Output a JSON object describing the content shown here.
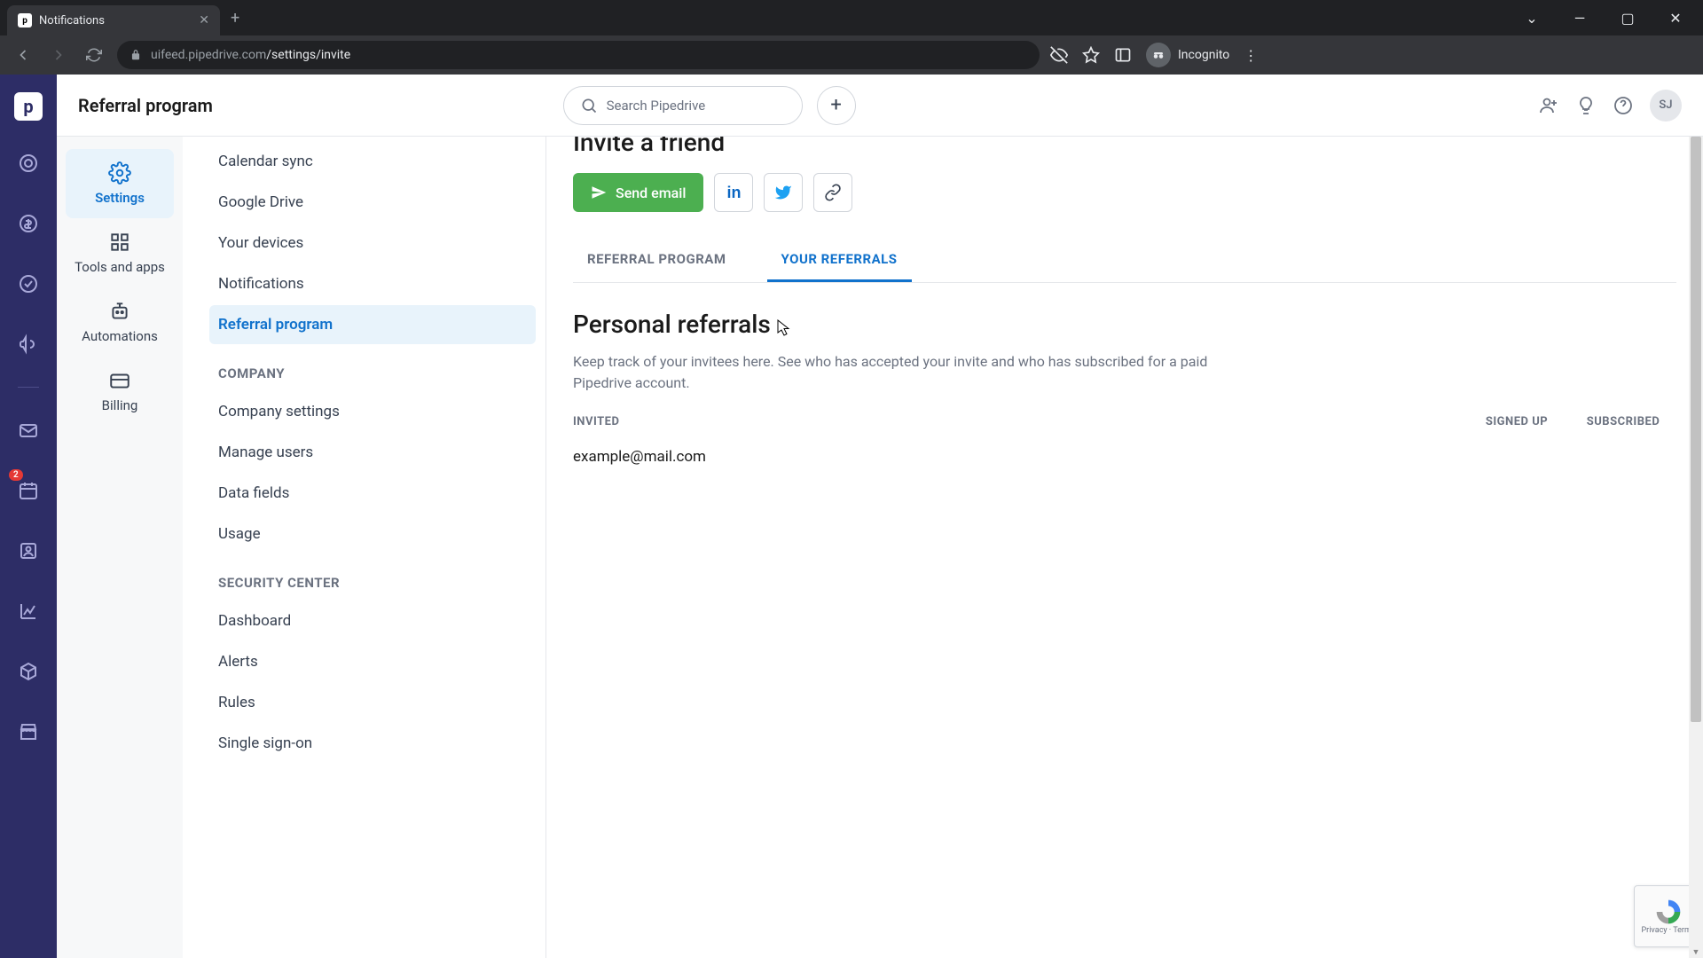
{
  "browser": {
    "tab_title": "Notifications",
    "url_host": "uifeed.pipedrive.com",
    "url_path": "/settings/invite",
    "incognito_label": "Incognito"
  },
  "header": {
    "page_title": "Referral program",
    "search_placeholder": "Search Pipedrive",
    "avatar_initials": "SJ"
  },
  "rail_badge": "2",
  "sidebar1": {
    "items": [
      {
        "label": "Settings",
        "icon": "gear-icon"
      },
      {
        "label": "Tools and apps",
        "icon": "grid-icon"
      },
      {
        "label": "Automations",
        "icon": "bot-icon"
      },
      {
        "label": "Billing",
        "icon": "card-icon"
      }
    ]
  },
  "sidebar2": {
    "top": [
      "Calendar sync",
      "Google Drive",
      "Your devices",
      "Notifications",
      "Referral program"
    ],
    "groups": [
      {
        "header": "COMPANY",
        "items": [
          "Company settings",
          "Manage users",
          "Data fields",
          "Usage"
        ]
      },
      {
        "header": "SECURITY CENTER",
        "items": [
          "Dashboard",
          "Alerts",
          "Rules",
          "Single sign-on"
        ]
      }
    ]
  },
  "invite": {
    "heading": "Invite a friend",
    "send_label": "Send email"
  },
  "tabs": {
    "a": "REFERRAL PROGRAM",
    "b": "YOUR REFERRALS"
  },
  "referrals": {
    "title": "Personal referrals",
    "desc": "Keep track of your invitees here. See who has accepted your invite and who has subscribed for a paid Pipedrive account.",
    "col_invited": "INVITED",
    "col_signed": "SIGNED UP",
    "col_sub": "SUBSCRIBED",
    "rows": [
      {
        "email": "example@mail.com"
      }
    ]
  },
  "recaptcha": {
    "line1": "Privacy",
    "line2": "Terms"
  }
}
